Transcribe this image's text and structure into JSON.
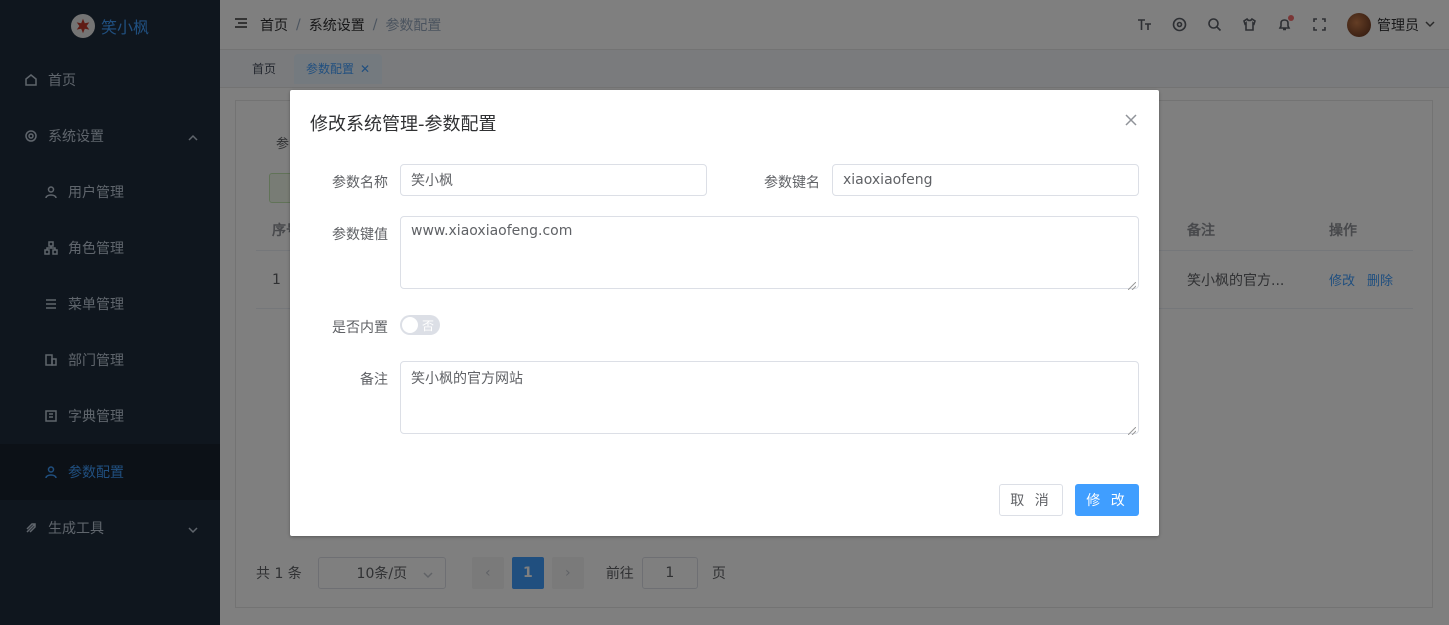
{
  "app": {
    "logo_text": "笑小枫"
  },
  "sidebar": {
    "items": [
      {
        "label": "首页",
        "icon": "home-icon"
      },
      {
        "label": "系统设置",
        "icon": "gear-icon",
        "expanded": true
      },
      {
        "label": "生成工具",
        "icon": "rocket-icon"
      }
    ],
    "sub_items": [
      {
        "label": "用户管理",
        "icon": "user-icon"
      },
      {
        "label": "角色管理",
        "icon": "tree-icon"
      },
      {
        "label": "菜单管理",
        "icon": "menu-icon"
      },
      {
        "label": "部门管理",
        "icon": "building-icon"
      },
      {
        "label": "字典管理",
        "icon": "book-icon"
      },
      {
        "label": "参数配置",
        "icon": "user-icon",
        "active": true
      }
    ]
  },
  "navbar": {
    "breadcrumb": [
      "首页",
      "系统设置",
      "参数配置"
    ],
    "user_name": "管理员"
  },
  "tags": [
    {
      "label": "首页",
      "active": false
    },
    {
      "label": "参数配置",
      "active": true
    }
  ],
  "table": {
    "headers": [
      "序号",
      "备注",
      "操作"
    ],
    "row": {
      "index": "1",
      "remark": "笑小枫的官方...",
      "edit": "修改",
      "delete": "删除"
    }
  },
  "pagination": {
    "total_text": "共 1 条",
    "page_size": "10条/页",
    "current_page": "1",
    "goto_label": "前往",
    "goto_value": "1",
    "page_suffix": "页"
  },
  "dialog": {
    "title": "修改系统管理-参数配置",
    "fields": {
      "name_label": "参数名称",
      "name_value": "笑小枫",
      "key_label": "参数键名",
      "key_value": "xiaoxiaofeng",
      "value_label": "参数键值",
      "value_value": "www.xiaoxiaofeng.com",
      "builtin_label": "是否内置",
      "builtin_value": "否",
      "remark_label": "备注",
      "remark_value": "笑小枫的官方网站"
    },
    "cancel_label": "取 消",
    "submit_label": "修 改"
  },
  "colors": {
    "primary": "#409eff",
    "sidebar_bg": "#1f2d3d",
    "danger": "#f56c6c"
  }
}
